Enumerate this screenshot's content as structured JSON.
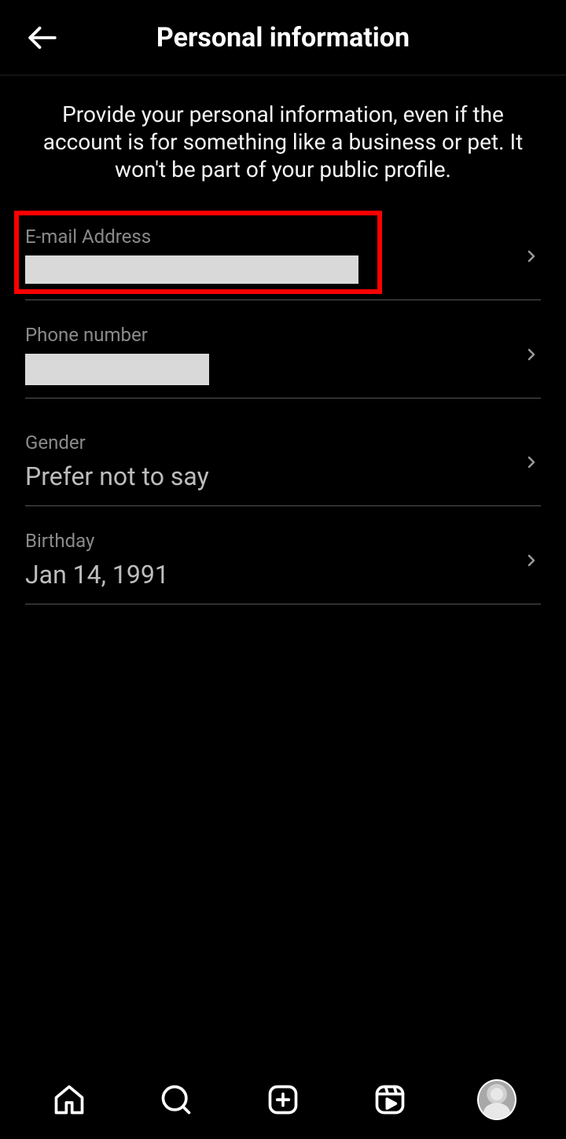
{
  "header": {
    "title": "Personal information"
  },
  "description": "Provide your personal information, even if the account is for something like a business or pet. It won't be part of your public profile.",
  "fields": {
    "email": {
      "label": "E-mail Address",
      "value": ""
    },
    "phone": {
      "label": "Phone number",
      "value": ""
    },
    "gender": {
      "label": "Gender",
      "value": "Prefer not to say"
    },
    "birthday": {
      "label": "Birthday",
      "value": "Jan 14, 1991"
    }
  },
  "highlight": {
    "target": "email"
  }
}
